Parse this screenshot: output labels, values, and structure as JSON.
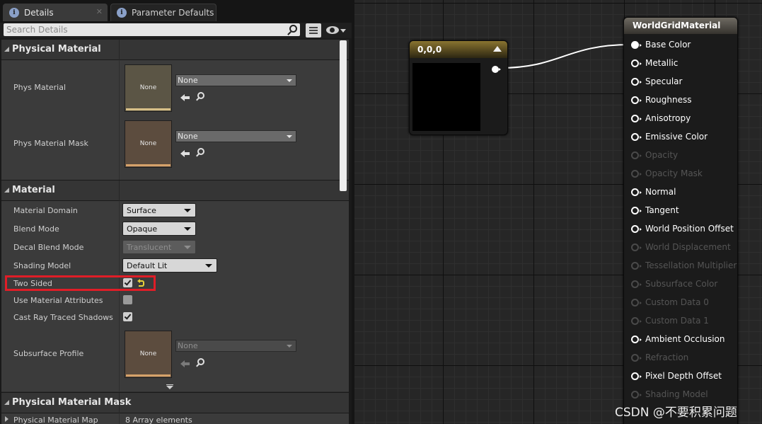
{
  "tabs": [
    {
      "label": "Details",
      "icon": "info-icon"
    },
    {
      "label": "Parameter Defaults",
      "icon": "info-icon"
    }
  ],
  "search": {
    "placeholder": "Search Details"
  },
  "categories": {
    "physical_material": "Physical Material",
    "material": "Material",
    "physical_material_mask": "Physical Material Mask"
  },
  "physical_material": {
    "phys_material": {
      "label": "Phys Material",
      "thumb_text": "None",
      "value": "None"
    },
    "phys_material_mask": {
      "label": "Phys Material Mask",
      "thumb_text": "None",
      "value": "None"
    }
  },
  "material": {
    "material_domain": {
      "label": "Material Domain",
      "value": "Surface"
    },
    "blend_mode": {
      "label": "Blend Mode",
      "value": "Opaque"
    },
    "decal_blend_mode": {
      "label": "Decal Blend Mode",
      "value": "Translucent"
    },
    "shading_model": {
      "label": "Shading Model",
      "value": "Default Lit"
    },
    "two_sided": {
      "label": "Two Sided",
      "checked": true
    },
    "use_material_attributes": {
      "label": "Use Material Attributes",
      "checked": false
    },
    "cast_ray_traced_shadows": {
      "label": "Cast Ray Traced Shadows",
      "checked": true
    },
    "subsurface_profile": {
      "label": "Subsurface Profile",
      "thumb_text": "None",
      "value": "None"
    }
  },
  "physical_material_mask_section": {
    "map_label": "Physical Material Map",
    "map_value": "8 Array elements"
  },
  "graph": {
    "constant_node": {
      "title": "0,0,0",
      "color": "#000000"
    },
    "material_node": {
      "title": "WorldGridMaterial",
      "pins": [
        {
          "label": "Base Color",
          "enabled": true,
          "connected": true
        },
        {
          "label": "Metallic",
          "enabled": true
        },
        {
          "label": "Specular",
          "enabled": true
        },
        {
          "label": "Roughness",
          "enabled": true
        },
        {
          "label": "Anisotropy",
          "enabled": true
        },
        {
          "label": "Emissive Color",
          "enabled": true
        },
        {
          "label": "Opacity",
          "enabled": false
        },
        {
          "label": "Opacity Mask",
          "enabled": false
        },
        {
          "label": "Normal",
          "enabled": true
        },
        {
          "label": "Tangent",
          "enabled": true
        },
        {
          "label": "World Position Offset",
          "enabled": true
        },
        {
          "label": "World Displacement",
          "enabled": false
        },
        {
          "label": "Tessellation Multiplier",
          "enabled": false
        },
        {
          "label": "Subsurface Color",
          "enabled": false
        },
        {
          "label": "Custom Data 0",
          "enabled": false
        },
        {
          "label": "Custom Data 1",
          "enabled": false
        },
        {
          "label": "Ambient Occlusion",
          "enabled": true
        },
        {
          "label": "Refraction",
          "enabled": false
        },
        {
          "label": "Pixel Depth Offset",
          "enabled": true
        },
        {
          "label": "Shading Model",
          "enabled": false
        }
      ]
    }
  },
  "watermark": "CSDN @不要积累问题",
  "colors": {
    "highlight": "#e01d27",
    "header_gold": "#8a7430",
    "reset_arrow": "#e8d23a"
  }
}
